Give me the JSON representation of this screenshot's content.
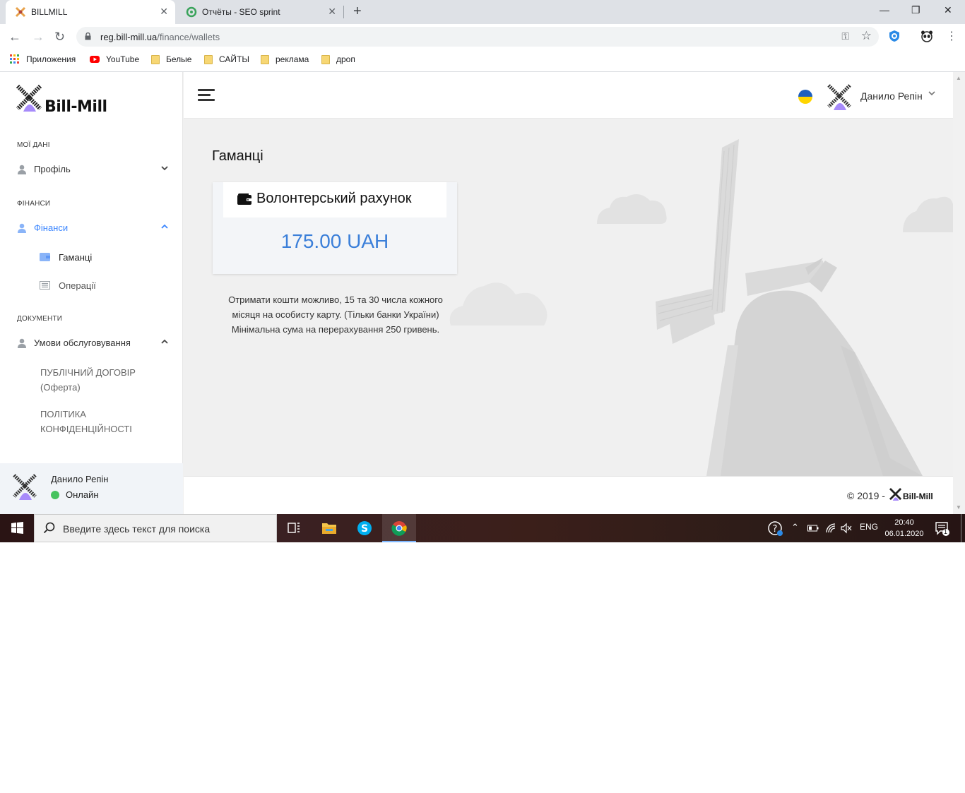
{
  "browser": {
    "tabs": [
      {
        "title": "BILLMILL",
        "active": true
      },
      {
        "title": "Отчёты - SEO sprint",
        "active": false
      }
    ],
    "new_tab": "+",
    "window_controls": {
      "minimize": "—",
      "maximize": "❐",
      "close": "✕"
    },
    "url_host": "reg.bill-mill.ua",
    "url_path": "/finance/wallets",
    "bookmarks": [
      {
        "label": "Приложения",
        "icon": "apps-grid-icon"
      },
      {
        "label": "YouTube",
        "icon": "youtube-icon"
      },
      {
        "label": "Белые",
        "icon": "folder-icon"
      },
      {
        "label": "САЙТЫ",
        "icon": "folder-icon"
      },
      {
        "label": "реклама",
        "icon": "folder-icon"
      },
      {
        "label": "дроп",
        "icon": "folder-icon"
      }
    ]
  },
  "sidebar": {
    "brand": "Bill-Mill",
    "sections": {
      "my_data": "МОЇ ДАНІ",
      "finance": "ФІНАНСИ",
      "documents": "ДОКУМЕНТИ"
    },
    "profile_label": "Профіль",
    "finance_label": "Фінанси",
    "wallets_label": "Гаманці",
    "operations_label": "Операції",
    "terms_label": "Умови обслуговування",
    "public_contract": "ПУБЛІЧНИЙ ДОГОВІР (Оферта)",
    "privacy_policy": "ПОЛІТИКА КОНФІДЕНЦІЙНОСТІ",
    "user_name": "Данило Репін",
    "user_status": "Онлайн"
  },
  "topbar": {
    "user_name": "Данило Репін"
  },
  "main": {
    "title": "Гаманці",
    "wallet": {
      "name": "Волонтерський рахунок",
      "amount": "175.00 UAH"
    },
    "note": "Отримати кошти можливо, 15 та 30 числа кожного місяця на особисту карту. (Тільки банки України) Мінімальна сума на перерахування 250 гривень."
  },
  "footer": {
    "copyright": "© 2019 -",
    "brand": "Bill-Mill"
  },
  "taskbar": {
    "search_placeholder": "Введите здесь текст для поиска",
    "language": "ENG",
    "time": "20:40",
    "date": "06.01.2020",
    "notification_count": "1"
  },
  "colors": {
    "accent": "#3b86ff",
    "amount": "#3b7fd9",
    "online": "#46c35f"
  }
}
